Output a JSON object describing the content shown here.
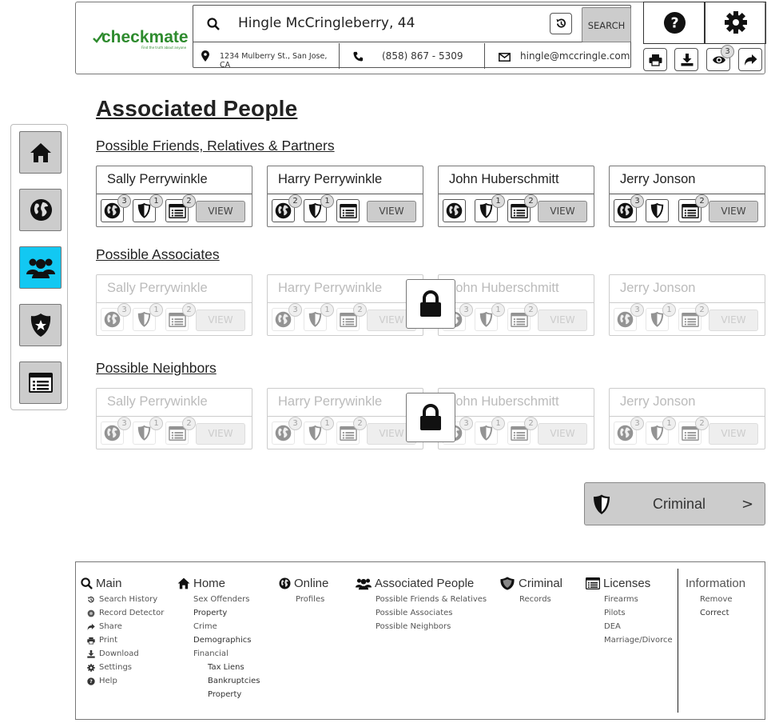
{
  "header": {
    "logo_text": "checkmate",
    "logo_tagline": "Find the truth about anyone",
    "search_value": "Hingle McCringleberry, 44",
    "search_button": "SEARCH",
    "address": "1234 Mulberry St., San Jose, CA",
    "phone": "(858) 867 - 5309",
    "email": "hingle@mccringle.com",
    "watch_count": "3"
  },
  "page": {
    "title": "Associated People"
  },
  "sections": [
    {
      "title": "Possible Friends, Relatives & Partners",
      "locked": false,
      "cards": [
        {
          "name": "Sally Perrywinkle",
          "online": "3",
          "criminal": "1",
          "records": "2",
          "view": "VIEW"
        },
        {
          "name": "Harry Perrywinkle",
          "online": "2",
          "criminal": "1",
          "records": "",
          "view": "VIEW"
        },
        {
          "name": "John Huberschmitt",
          "online": "",
          "criminal": "1",
          "records": "2",
          "view": "VIEW"
        },
        {
          "name": "Jerry Jonson",
          "online": "3",
          "criminal": "",
          "records": "2",
          "view": "VIEW"
        }
      ]
    },
    {
      "title": "Possible Associates",
      "locked": true,
      "cards": [
        {
          "name": "Sally Perrywinkle",
          "online": "3",
          "criminal": "1",
          "records": "2",
          "view": "VIEW"
        },
        {
          "name": "Harry Perrywinkle",
          "online": "3",
          "criminal": "1",
          "records": "2",
          "view": "VIEW"
        },
        {
          "name": "John Huberschmitt",
          "online": "3",
          "criminal": "1",
          "records": "2",
          "view": "VIEW"
        },
        {
          "name": "Jerry Jonson",
          "online": "3",
          "criminal": "1",
          "records": "2",
          "view": "VIEW"
        }
      ]
    },
    {
      "title": "Possible Neighbors",
      "locked": true,
      "cards": [
        {
          "name": "Sally Perrywinkle",
          "online": "3",
          "criminal": "1",
          "records": "2",
          "view": "VIEW"
        },
        {
          "name": "Harry Perrywinkle",
          "online": "3",
          "criminal": "1",
          "records": "2",
          "view": "VIEW"
        },
        {
          "name": "John Huberschmitt",
          "online": "3",
          "criminal": "1",
          "records": "2",
          "view": "VIEW"
        },
        {
          "name": "Jerry Jonson",
          "online": "3",
          "criminal": "1",
          "records": "2",
          "view": "VIEW"
        }
      ]
    }
  ],
  "next_button": {
    "label": "Criminal",
    "arrow": ">"
  },
  "footer": {
    "main": {
      "title": "Main",
      "items": [
        "Search History",
        "Record Detector",
        "Share",
        "Print",
        "Download",
        "Settings",
        "Help"
      ]
    },
    "home": {
      "title": "Home",
      "items": [
        "Sex Offenders",
        "Property",
        "Crime",
        "Demographics",
        "Financial"
      ],
      "sub_items": [
        "Tax Liens",
        "Bankruptcies",
        "Property"
      ]
    },
    "online": {
      "title": "Online",
      "items": [
        "Profiles"
      ]
    },
    "associated": {
      "title": "Associated People",
      "items": [
        "Possible Friends & Relatives",
        "Possible Associates",
        "Possible Neighbors"
      ]
    },
    "criminal": {
      "title": "Criminal",
      "items": [
        "Records"
      ]
    },
    "licenses": {
      "title": "Licenses",
      "items": [
        "Firearms",
        "Pilots",
        "DEA",
        "Marriage/Divorce"
      ]
    },
    "information": {
      "title": "Information",
      "items": [
        "Remove",
        "Correct"
      ]
    }
  }
}
